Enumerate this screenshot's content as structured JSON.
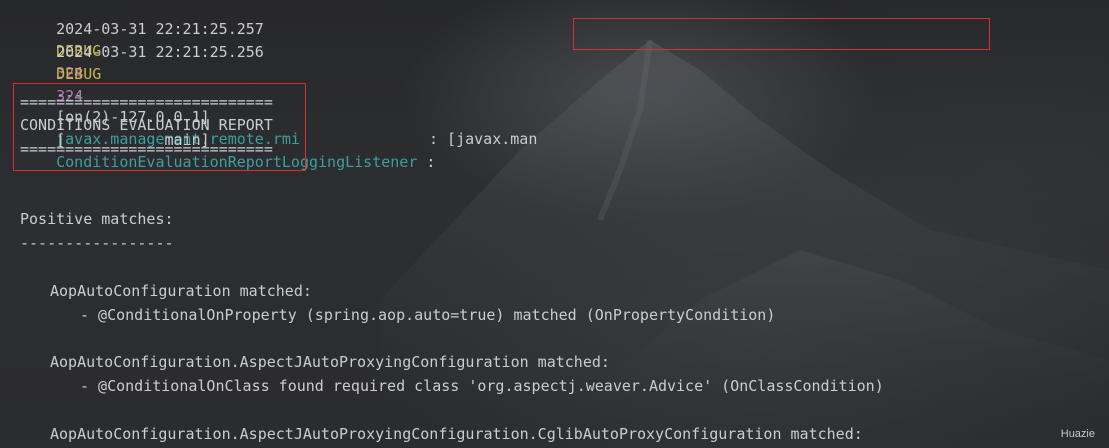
{
  "log_lines": [
    {
      "timestamp": "2024-03-31 22:21:25.257",
      "level": "DEBUG",
      "pid": "324",
      "separator": "---",
      "thread": "[on(2)-127.0.0.1]",
      "logger": "javax.management.remote.rmi",
      "tail": " : [javax.man"
    },
    {
      "timestamp": "2024-03-31 22:21:25.256",
      "level": "DEBUG",
      "pid": "324",
      "separator": "---",
      "thread": "[           main]",
      "logger": "ConditionEvaluationReportLoggingListener",
      "tail": " :"
    }
  ],
  "report": {
    "rule_top": "============================",
    "title": "CONDITIONS EVALUATION REPORT",
    "rule_bottom": "============================",
    "section_heading": "Positive matches:",
    "section_rule": "-----------------",
    "entries": [
      {
        "name": "AopAutoConfiguration matched:",
        "detail": "- @ConditionalOnProperty (spring.aop.auto=true) matched (OnPropertyCondition)"
      },
      {
        "name": "AopAutoConfiguration.AspectJAutoProxyingConfiguration matched:",
        "detail": "- @ConditionalOnClass found required class 'org.aspectj.weaver.Advice' (OnClassCondition)"
      },
      {
        "name": "AopAutoConfiguration.AspectJAutoProxyingConfiguration.CglibAutoProxyConfiguration matched:",
        "detail": ""
      }
    ]
  },
  "watermark": "Huazie",
  "colors": {
    "background": "#2a2b2d",
    "text": "#c9cdd2",
    "level_debug": "#c9b54b",
    "pid": "#b37ab8",
    "logger": "#3f9e9e",
    "highlight_border": "#d6312f"
  }
}
